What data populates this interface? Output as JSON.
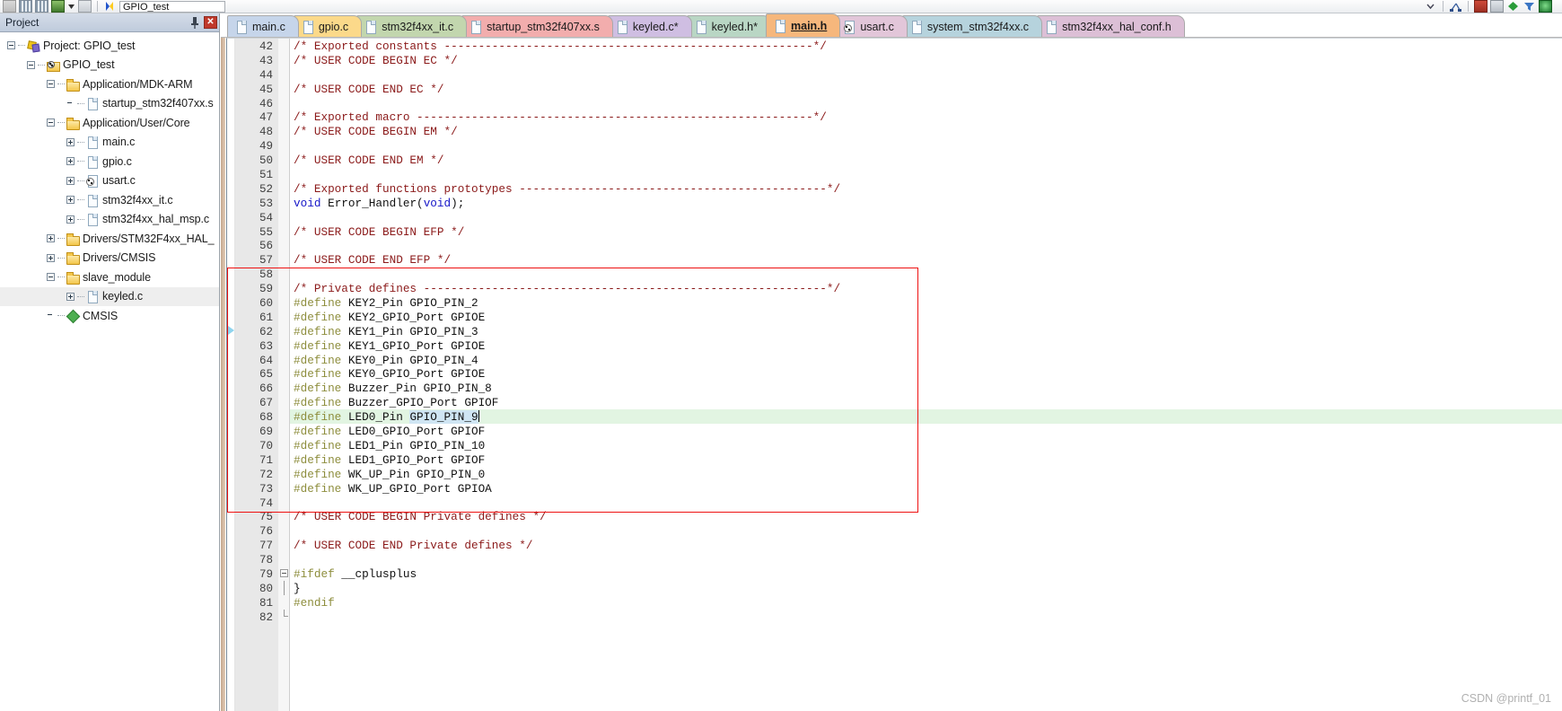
{
  "toolbar": {
    "project_combo_value": "GPIO_test",
    "icons": [
      "layers-icon",
      "grid-icon",
      "grid2-icon",
      "books-icon",
      "dropdown-arrow-icon",
      "manage-runtime-icon",
      "target-options-icon"
    ],
    "right_icons": [
      "chevron-down-icon",
      "tree-icon",
      "window-icon",
      "panes-icon",
      "diamond-icon",
      "filter-icon",
      "globe-icon"
    ]
  },
  "project_pane": {
    "title": "Project",
    "pin_icon": "pin-icon",
    "close_icon": "close-icon",
    "tree": [
      {
        "label": "Project: GPIO_test",
        "depth": 0,
        "icon": "project-icon",
        "expander": "minus",
        "selected": false
      },
      {
        "label": "GPIO_test",
        "depth": 1,
        "icon": "target-icon",
        "expander": "minus",
        "selected": false
      },
      {
        "label": "Application/MDK-ARM",
        "depth": 2,
        "icon": "folder-icon",
        "expander": "minus",
        "selected": false
      },
      {
        "label": "startup_stm32f407xx.s",
        "depth": 3,
        "icon": "file-icon",
        "expander": "none",
        "selected": false
      },
      {
        "label": "Application/User/Core",
        "depth": 2,
        "icon": "folder-icon",
        "expander": "minus",
        "selected": false
      },
      {
        "label": "main.c",
        "depth": 3,
        "icon": "file-icon",
        "expander": "plus",
        "selected": false
      },
      {
        "label": "gpio.c",
        "depth": 3,
        "icon": "file-icon",
        "expander": "plus",
        "selected": false
      },
      {
        "label": "usart.c",
        "depth": 3,
        "icon": "file-src-icon",
        "expander": "plus",
        "selected": false
      },
      {
        "label": "stm32f4xx_it.c",
        "depth": 3,
        "icon": "file-icon",
        "expander": "plus",
        "selected": false
      },
      {
        "label": "stm32f4xx_hal_msp.c",
        "depth": 3,
        "icon": "file-icon",
        "expander": "plus",
        "selected": false
      },
      {
        "label": "Drivers/STM32F4xx_HAL_",
        "depth": 2,
        "icon": "folder-icon",
        "expander": "plus",
        "selected": false
      },
      {
        "label": "Drivers/CMSIS",
        "depth": 2,
        "icon": "folder-icon",
        "expander": "plus",
        "selected": false
      },
      {
        "label": "slave_module",
        "depth": 2,
        "icon": "folder-icon",
        "expander": "minus",
        "selected": false
      },
      {
        "label": "keyled.c",
        "depth": 3,
        "icon": "file-icon",
        "expander": "plus",
        "selected": true
      },
      {
        "label": "CMSIS",
        "depth": 2,
        "icon": "cmsis-icon",
        "expander": "none",
        "selected": false
      }
    ]
  },
  "tabs": [
    {
      "label": "main.c",
      "color": "#c6d5ea",
      "active": false,
      "icon": "file-icon",
      "modified": false
    },
    {
      "label": "gpio.c",
      "color": "#fbd98a",
      "active": false,
      "icon": "file-icon",
      "modified": false
    },
    {
      "label": "stm32f4xx_it.c",
      "color": "#c2d6ae",
      "active": false,
      "icon": "file-icon",
      "modified": false
    },
    {
      "label": "startup_stm32f407xx.s",
      "color": "#f2adad",
      "active": false,
      "icon": "file-icon",
      "modified": false
    },
    {
      "label": "keyled.c*",
      "color": "#cfbee2",
      "active": false,
      "icon": "file-icon",
      "modified": true
    },
    {
      "label": "keyled.h*",
      "color": "#b9d6c4",
      "active": false,
      "icon": "file-icon",
      "modified": true
    },
    {
      "label": "main.h",
      "color": "#f6b77c",
      "active": true,
      "icon": "file-icon",
      "modified": false
    },
    {
      "label": "usart.c",
      "color": "#e2c6d9",
      "active": false,
      "icon": "gear-file-icon",
      "modified": false
    },
    {
      "label": "system_stm32f4xx.c",
      "color": "#b6d3dd",
      "active": false,
      "icon": "file-icon",
      "modified": false
    },
    {
      "label": "stm32f4xx_hal_conf.h",
      "color": "#dcbfd6",
      "active": false,
      "icon": "file-icon",
      "modified": false
    }
  ],
  "editor": {
    "first_line": 42,
    "highlight_line": 68,
    "bookmark_line": 62,
    "selection": {
      "line": 68,
      "text": "GPIO_PIN_9"
    },
    "lines": [
      {
        "n": 42,
        "tokens": [
          {
            "t": "/* Exported constants ------------------------------------------------------*/",
            "c": "cmt"
          }
        ]
      },
      {
        "n": 43,
        "tokens": [
          {
            "t": "/* USER CODE BEGIN EC */",
            "c": "cmt"
          }
        ]
      },
      {
        "n": 44,
        "tokens": []
      },
      {
        "n": 45,
        "tokens": [
          {
            "t": "/* USER CODE END EC */",
            "c": "cmt"
          }
        ]
      },
      {
        "n": 46,
        "tokens": []
      },
      {
        "n": 47,
        "tokens": [
          {
            "t": "/* Exported macro ----------------------------------------------------------*/",
            "c": "cmt"
          }
        ]
      },
      {
        "n": 48,
        "tokens": [
          {
            "t": "/* USER CODE BEGIN EM */",
            "c": "cmt"
          }
        ]
      },
      {
        "n": 49,
        "tokens": []
      },
      {
        "n": 50,
        "tokens": [
          {
            "t": "/* USER CODE END EM */",
            "c": "cmt"
          }
        ]
      },
      {
        "n": 51,
        "tokens": []
      },
      {
        "n": 52,
        "tokens": [
          {
            "t": "/* Exported functions prototypes ---------------------------------------------*/",
            "c": "cmt"
          }
        ]
      },
      {
        "n": 53,
        "tokens": [
          {
            "t": "void",
            "c": "kw"
          },
          {
            "t": " Error_Handler(",
            "c": ""
          },
          {
            "t": "void",
            "c": "kw"
          },
          {
            "t": ");",
            "c": ""
          }
        ]
      },
      {
        "n": 54,
        "tokens": []
      },
      {
        "n": 55,
        "tokens": [
          {
            "t": "/* USER CODE BEGIN EFP */",
            "c": "cmt"
          }
        ]
      },
      {
        "n": 56,
        "tokens": []
      },
      {
        "n": 57,
        "tokens": [
          {
            "t": "/* USER CODE END EFP */",
            "c": "cmt"
          }
        ]
      },
      {
        "n": 58,
        "tokens": []
      },
      {
        "n": 59,
        "tokens": [
          {
            "t": "/* Private defines -----------------------------------------------------------*/",
            "c": "cmt"
          }
        ]
      },
      {
        "n": 60,
        "tokens": [
          {
            "t": "#define",
            "c": "pp"
          },
          {
            "t": " KEY2_Pin GPIO_PIN_2",
            "c": ""
          }
        ]
      },
      {
        "n": 61,
        "tokens": [
          {
            "t": "#define",
            "c": "pp"
          },
          {
            "t": " KEY2_GPIO_Port GPIOE",
            "c": ""
          }
        ]
      },
      {
        "n": 62,
        "tokens": [
          {
            "t": "#define",
            "c": "pp"
          },
          {
            "t": " KEY1_Pin GPIO_PIN_3",
            "c": ""
          }
        ]
      },
      {
        "n": 63,
        "tokens": [
          {
            "t": "#define",
            "c": "pp"
          },
          {
            "t": " KEY1_GPIO_Port GPIOE",
            "c": ""
          }
        ]
      },
      {
        "n": 64,
        "tokens": [
          {
            "t": "#define",
            "c": "pp"
          },
          {
            "t": " KEY0_Pin GPIO_PIN_4",
            "c": ""
          }
        ]
      },
      {
        "n": 65,
        "tokens": [
          {
            "t": "#define",
            "c": "pp"
          },
          {
            "t": " KEY0_GPIO_Port GPIOE",
            "c": ""
          }
        ]
      },
      {
        "n": 66,
        "tokens": [
          {
            "t": "#define",
            "c": "pp"
          },
          {
            "t": " Buzzer_Pin GPIO_PIN_8",
            "c": ""
          }
        ]
      },
      {
        "n": 67,
        "tokens": [
          {
            "t": "#define",
            "c": "pp"
          },
          {
            "t": " Buzzer_GPIO_Port GPIOF",
            "c": ""
          }
        ]
      },
      {
        "n": 68,
        "tokens": [
          {
            "t": "#define",
            "c": "pp"
          },
          {
            "t": " LED0_Pin ",
            "c": ""
          },
          {
            "t": "GPIO_PIN_9",
            "c": "sel"
          }
        ]
      },
      {
        "n": 69,
        "tokens": [
          {
            "t": "#define",
            "c": "pp"
          },
          {
            "t": " LED0_GPIO_Port GPIOF",
            "c": ""
          }
        ]
      },
      {
        "n": 70,
        "tokens": [
          {
            "t": "#define",
            "c": "pp"
          },
          {
            "t": " LED1_Pin GPIO_PIN_10",
            "c": ""
          }
        ]
      },
      {
        "n": 71,
        "tokens": [
          {
            "t": "#define",
            "c": "pp"
          },
          {
            "t": " LED1_GPIO_Port GPIOF",
            "c": ""
          }
        ]
      },
      {
        "n": 72,
        "tokens": [
          {
            "t": "#define",
            "c": "pp"
          },
          {
            "t": " WK_UP_Pin GPIO_PIN_0",
            "c": ""
          }
        ]
      },
      {
        "n": 73,
        "tokens": [
          {
            "t": "#define",
            "c": "pp"
          },
          {
            "t": " WK_UP_GPIO_Port GPIOA",
            "c": ""
          }
        ]
      },
      {
        "n": 74,
        "tokens": []
      },
      {
        "n": 75,
        "tokens": [
          {
            "t": "/* USER CODE BEGIN Private defines */",
            "c": "cmt"
          }
        ]
      },
      {
        "n": 76,
        "tokens": []
      },
      {
        "n": 77,
        "tokens": [
          {
            "t": "/* USER CODE END Private defines */",
            "c": "cmt"
          }
        ]
      },
      {
        "n": 78,
        "tokens": []
      },
      {
        "n": 79,
        "tokens": [
          {
            "t": "#ifdef",
            "c": "pp"
          },
          {
            "t": " __cplusplus",
            "c": ""
          }
        ],
        "fold": "box"
      },
      {
        "n": 80,
        "tokens": [
          {
            "t": "}",
            "c": ""
          }
        ],
        "fold": "line"
      },
      {
        "n": 81,
        "tokens": [
          {
            "t": "#endif",
            "c": "pp"
          }
        ]
      },
      {
        "n": 82,
        "tokens": [],
        "fold": "end"
      }
    ]
  },
  "annotation": {
    "redbox_label": "private-defines-highlight-box"
  },
  "watermark": "CSDN @printf_01",
  "colors": {
    "comment": "#8b1a1a",
    "keyword": "#1616c8",
    "preprocessor": "#8d8d3c",
    "highlight_line_bg": "#e2f5e2",
    "selection_bg": "#cfe5f3",
    "annotation_red": "#ee1111"
  }
}
